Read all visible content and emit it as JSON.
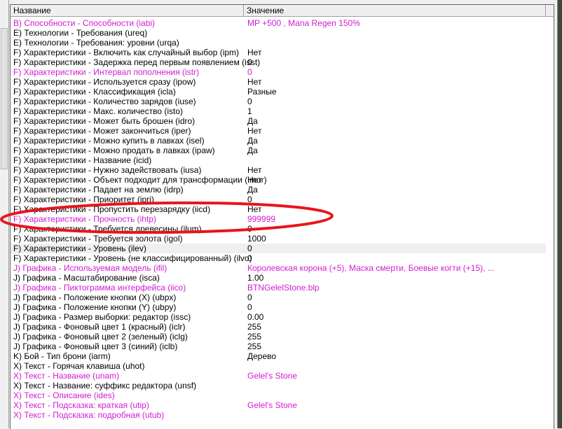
{
  "columns": {
    "name": "Название",
    "value": "Значение"
  },
  "colors": {
    "modified": "#d21ad2",
    "normal": "#000000",
    "annotation": "#e8141c"
  },
  "rows": [
    {
      "name": "B) Способности - Способности (iabi)",
      "value": "MP +500 , Mana Regen 150%",
      "modified": true
    },
    {
      "name": "E) Технологии - Требования (ureq)",
      "value": "",
      "modified": false
    },
    {
      "name": "E) Технологии - Требования: уровни (urqa)",
      "value": "",
      "modified": false
    },
    {
      "name": "F) Характеристики - Включить как случайный выбор (ipm)",
      "value": "Нет",
      "modified": false
    },
    {
      "name": "F) Характеристики - Задержка перед первым появлением (isst)",
      "value": "0",
      "modified": false
    },
    {
      "name": "F) Характеристики - Интервал пополнения (istr)",
      "value": "0",
      "modified": true
    },
    {
      "name": "F) Характеристики - Используется сразу (ipow)",
      "value": "Нет",
      "modified": false
    },
    {
      "name": "F) Характеристики - Классификация (icla)",
      "value": "Разные",
      "modified": false
    },
    {
      "name": "F) Характеристики - Количество зарядов (iuse)",
      "value": "0",
      "modified": false
    },
    {
      "name": "F) Характеристики - Макс. количество (isto)",
      "value": "1",
      "modified": false
    },
    {
      "name": "F) Характеристики - Может быть брошен (idro)",
      "value": "Да",
      "modified": false
    },
    {
      "name": "F) Характеристики - Может закончиться (iper)",
      "value": "Нет",
      "modified": false
    },
    {
      "name": "F) Характеристики - Можно купить в лавках (isel)",
      "value": "Да",
      "modified": false
    },
    {
      "name": "F) Характеристики - Можно продать в лавках (ipaw)",
      "value": "Да",
      "modified": false
    },
    {
      "name": "F) Характеристики - Название (icid)",
      "value": "",
      "modified": false
    },
    {
      "name": "F) Характеристики - Нужно задействовать (iusa)",
      "value": "Нет",
      "modified": false
    },
    {
      "name": "F) Характеристики - Объект подходит для трансформации (imor)",
      "value": "Нет",
      "modified": false
    },
    {
      "name": "F) Характеристики - Падает на землю (idrp)",
      "value": "Да",
      "modified": false
    },
    {
      "name": "F) Характеристики - Приоритет (ipri)",
      "value": "0",
      "modified": false
    },
    {
      "name": "F) Характеристики - Пропустить перезарядку (iicd)",
      "value": "Нет",
      "modified": false
    },
    {
      "name": "F) Характеристики - Прочность (ihtp)",
      "value": "999999",
      "modified": true
    },
    {
      "name": "F) Характеристики - Требуется древесины (ilum)",
      "value": "0",
      "modified": false
    },
    {
      "name": "F) Характеристики - Требуется золота (igol)",
      "value": "1000",
      "modified": false
    },
    {
      "name": "F) Характеристики - Уровень (ilev)",
      "value": "0",
      "modified": false,
      "selected": true
    },
    {
      "name": "F) Характеристики - Уровень (не классифицированный) (ilvo)",
      "value": "0",
      "modified": false
    },
    {
      "name": "J) Графика - Используемая модель (ifil)",
      "value": "Королевская корона (+5), Маска смерти, Боевые когти (+15), ...",
      "modified": true
    },
    {
      "name": "J) Графика - Масштабирование (isca)",
      "value": "1.00",
      "modified": false
    },
    {
      "name": "J) Графика - Пиктограмма интерфейса (iico)",
      "value": "BTNGelelStone.blp",
      "modified": true
    },
    {
      "name": "J) Графика - Положение кнопки (X) (ubpx)",
      "value": "0",
      "modified": false
    },
    {
      "name": "J) Графика - Положение кнопки (Y) (ubpy)",
      "value": "0",
      "modified": false
    },
    {
      "name": "J) Графика - Размер выборки: редактор (issc)",
      "value": "0.00",
      "modified": false
    },
    {
      "name": "J) Графика - Фоновый цвет 1 (красный) (iclr)",
      "value": "255",
      "modified": false
    },
    {
      "name": "J) Графика - Фоновый цвет 2 (зеленый) (iclg)",
      "value": "255",
      "modified": false
    },
    {
      "name": "J) Графика - Фоновый цвет 3 (синий) (iclb)",
      "value": "255",
      "modified": false
    },
    {
      "name": "K) Бой - Тип брони (iarm)",
      "value": "Дерево",
      "modified": false
    },
    {
      "name": "X) Текст - Горячая клавиша (uhot)",
      "value": "",
      "modified": false
    },
    {
      "name": "X) Текст - Название (unam)",
      "value": "Gelel's Stone",
      "modified": true
    },
    {
      "name": "X) Текст - Название: суффикс редактора (unsf)",
      "value": "",
      "modified": false
    },
    {
      "name": "X) Текст - Описание (ides)",
      "value": "",
      "modified": true
    },
    {
      "name": "X) Текст - Подсказка: краткая (utip)",
      "value": "Gelel's Stone",
      "modified": true
    },
    {
      "name": "X) Текст - Подсказка: подробная (utub)",
      "value": "",
      "modified": true
    }
  ]
}
